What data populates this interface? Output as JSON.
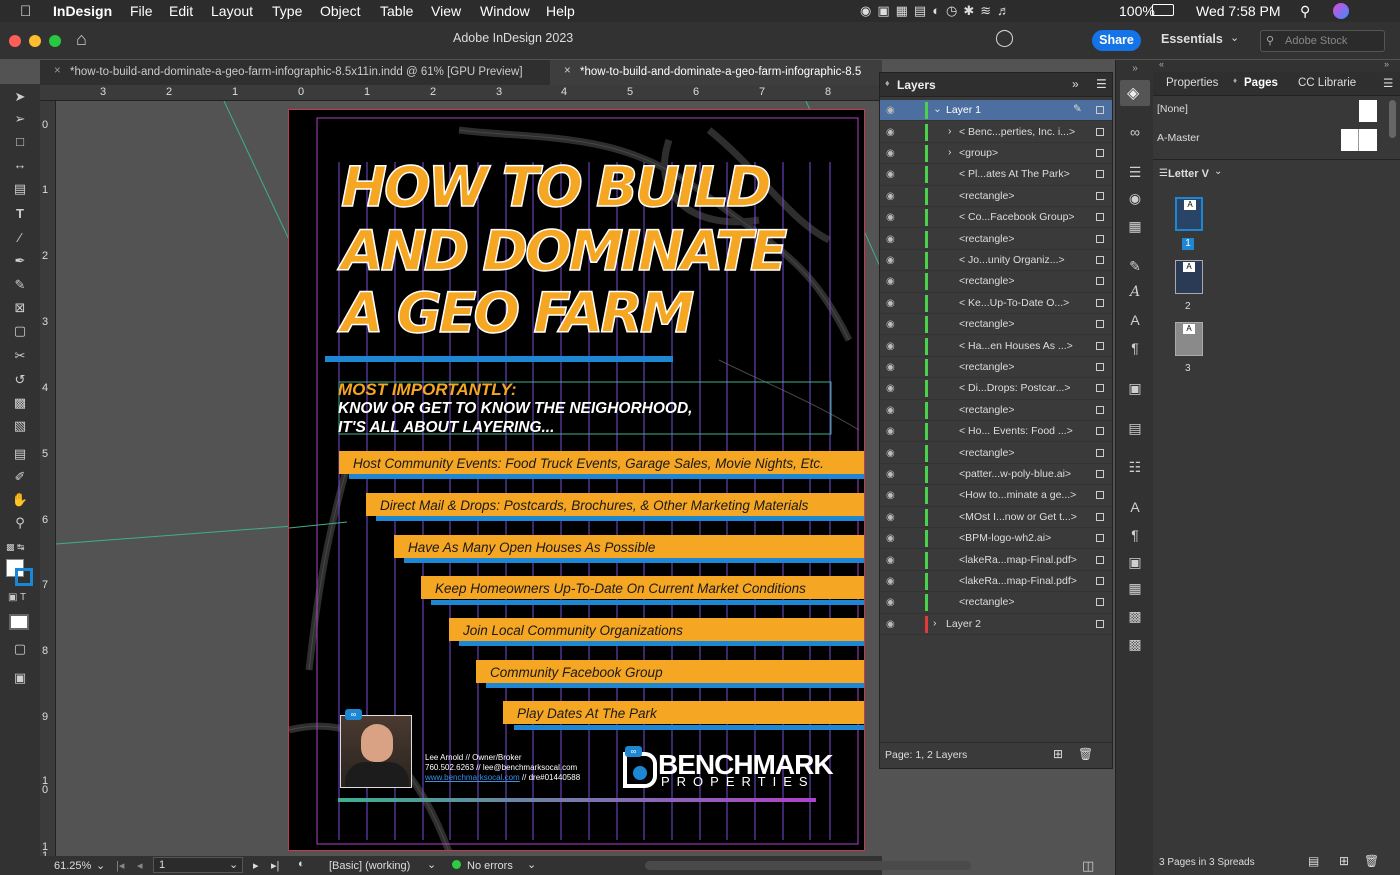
{
  "menubar": {
    "app": "InDesign",
    "items": [
      "File",
      "Edit",
      "Layout",
      "Type",
      "Object",
      "Table",
      "View",
      "Window",
      "Help"
    ],
    "battery": "100%",
    "clock": "Wed 7:58 PM"
  },
  "titlebar": {
    "title": "Adobe InDesign 2023",
    "share": "Share",
    "workspace": "Essentials",
    "stock_placeholder": "Adobe Stock"
  },
  "tabs": [
    {
      "label": "*how-to-build-and-dominate-a-geo-farm-infographic-8.5x11in.indd @ 61% [GPU Preview]"
    },
    {
      "label": "*how-to-build-and-dominate-a-geo-farm-infographic-8.5"
    }
  ],
  "ruler_h": [
    "3",
    "2",
    "1",
    "0",
    "1",
    "2",
    "3",
    "4",
    "5",
    "6",
    "7",
    "8"
  ],
  "ruler_v": [
    "0",
    "1",
    "2",
    "3",
    "4",
    "5",
    "6",
    "7",
    "8",
    "9",
    "1 0",
    "1 1"
  ],
  "doc": {
    "headline": [
      "HOW TO BUILD",
      "AND DOMINATE",
      "A GEO FARM"
    ],
    "sub1": "MOST IMPORTANTLY:",
    "sub2": "KNOW OR GET TO KNOW THE NEIGHORHOOD,",
    "sub3": "IT'S ALL ABOUT LAYERING...",
    "bars": [
      "Host Community Events: Food Truck Events, Garage Sales, Movie Nights, Etc.",
      "Direct Mail & Drops: Postcards, Brochures, & Other Marketing Materials",
      "Have As Many Open Houses As Possible",
      "Keep Homeowners Up-To-Date On Current Market Conditions",
      "Join Local Community Organizations",
      "Community Facebook Group",
      "Play Dates At The Park"
    ],
    "contact": {
      "line1": "Lee Arnold  //  Owner/Broker",
      "line2": "760.502.6263  //  lee@benchmarksocal.com",
      "line3_link": "www.benchmarksocal.com",
      "line3_rest": "  //  dre#01440588"
    },
    "logo_top": "BENCHMARK",
    "logo_bottom": "PROPERTIES"
  },
  "status": {
    "zoom": "61.25%",
    "page": "1",
    "style": "[Basic] (working)",
    "errors": "No errors"
  },
  "layers": {
    "title": "Layers",
    "rows": [
      {
        "name": "Layer 1",
        "selected": true
      },
      {
        "name": "<  Benc...perties, Inc. i...>"
      },
      {
        "name": "<group>"
      },
      {
        "name": "<   Pl...ates At The Park>"
      },
      {
        "name": "<rectangle>"
      },
      {
        "name": "<   Co...Facebook Group>"
      },
      {
        "name": "<rectangle>"
      },
      {
        "name": "<   Jo...unity Organiz...>"
      },
      {
        "name": "<rectangle>"
      },
      {
        "name": "<   Ke...Up-To-Date O...>"
      },
      {
        "name": "<rectangle>"
      },
      {
        "name": "<   Ha...en Houses As ...>"
      },
      {
        "name": "<rectangle>"
      },
      {
        "name": "<   Di...Drops: Postcar...>"
      },
      {
        "name": "<rectangle>"
      },
      {
        "name": "<   Ho... Events: Food ...>"
      },
      {
        "name": "<rectangle>"
      },
      {
        "name": "<patter...w-poly-blue.ai>"
      },
      {
        "name": "<How to...minate a ge...>"
      },
      {
        "name": "<MOst I...now or Get t...>"
      },
      {
        "name": "<BPM-logo-wh2.ai>"
      },
      {
        "name": "<lakeRa...map-Final.pdf>"
      },
      {
        "name": "<lakeRa...map-Final.pdf>"
      },
      {
        "name": "<rectangle>"
      },
      {
        "name": "Layer 2"
      }
    ],
    "footer": "Page: 1, 2 Layers"
  },
  "right_panel": {
    "tabs": [
      "Properties",
      "Pages",
      "CC Librarie"
    ],
    "none_label": "[None]",
    "master_label": "A-Master",
    "size_label": "Letter V",
    "pages": [
      "1",
      "2",
      "3"
    ],
    "footer": "3 Pages in 3 Spreads"
  },
  "colors": {
    "orange": "#f5a623",
    "blue": "#1e87d4",
    "share": "#1473e6"
  }
}
